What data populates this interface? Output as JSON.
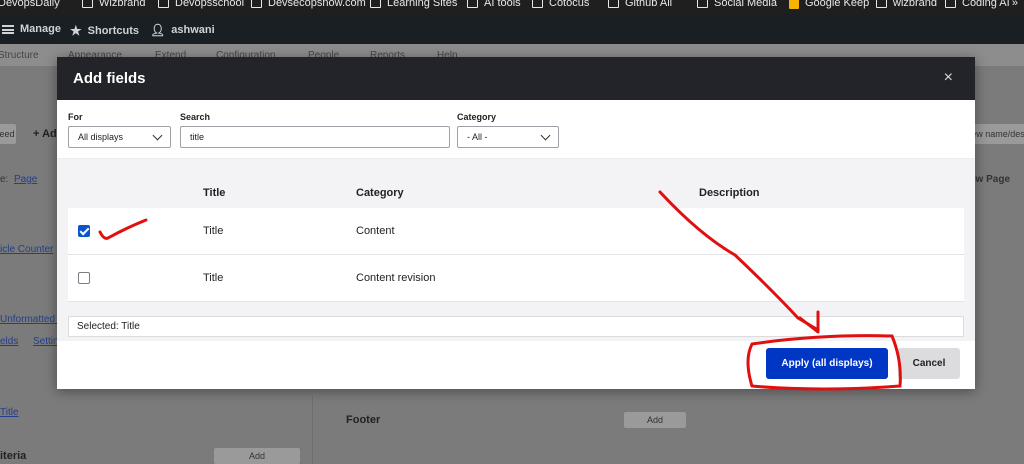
{
  "bookmarks": [
    {
      "label": "DevopsDaily",
      "icon": "folder-icon"
    },
    {
      "label": "Wizbrand",
      "icon": "folder-icon"
    },
    {
      "label": "Devopsschool",
      "icon": "folder-icon"
    },
    {
      "label": "Devsecopsnow.com",
      "icon": "folder-icon"
    },
    {
      "label": "Learning Sites",
      "icon": "folder-icon"
    },
    {
      "label": "AI tools",
      "icon": "folder-icon"
    },
    {
      "label": "Cotocus",
      "icon": "folder-icon"
    },
    {
      "label": "Github All",
      "icon": "folder-icon"
    },
    {
      "label": "Social Media",
      "icon": "folder-icon"
    },
    {
      "label": "Google Keep",
      "icon": "google-keep-icon"
    },
    {
      "label": "wizbrand",
      "icon": "folder-icon"
    },
    {
      "label": "Coding AI",
      "icon": "folder-icon"
    }
  ],
  "bookmarks_more": "»",
  "toolbar": {
    "manage": "Manage",
    "shortcuts": "Shortcuts",
    "user": "ashwani"
  },
  "tray": [
    "Structure",
    "Appearance",
    "Extend",
    "Configuration",
    "People",
    "Reports",
    "Help"
  ],
  "background": {
    "add_label": "+ Add",
    "seed_label": "eed",
    "type_label": "e:",
    "page_link": "Page",
    "counter_link": "icle Counter",
    "unformatted_link": "Unformatted l",
    "fields_link": "elds",
    "settings_link": "Settin",
    "title_link": "Title",
    "criteria_label": "iteria",
    "footer_label": "Footer",
    "add_btn": "Add",
    "new_name": "ew name/des",
    "new_page": "ew Page"
  },
  "modal": {
    "title": "Add fields",
    "close": "×",
    "filters": {
      "for_label": "For",
      "for_value": "All displays",
      "search_label": "Search",
      "search_value": "title",
      "category_label": "Category",
      "category_value": "- All -"
    },
    "table": {
      "headers": [
        "Title",
        "Category",
        "Description"
      ],
      "rows": [
        {
          "checked": true,
          "title": "Title",
          "category": "Content",
          "description": ""
        },
        {
          "checked": false,
          "title": "Title",
          "category": "Content revision",
          "description": ""
        }
      ]
    },
    "selected_text": "Selected: Title",
    "apply_label": "Apply (all displays)",
    "cancel_label": "Cancel"
  },
  "colors": {
    "accent": "#0036c4",
    "annotation": "#e01010",
    "header": "#232429"
  }
}
